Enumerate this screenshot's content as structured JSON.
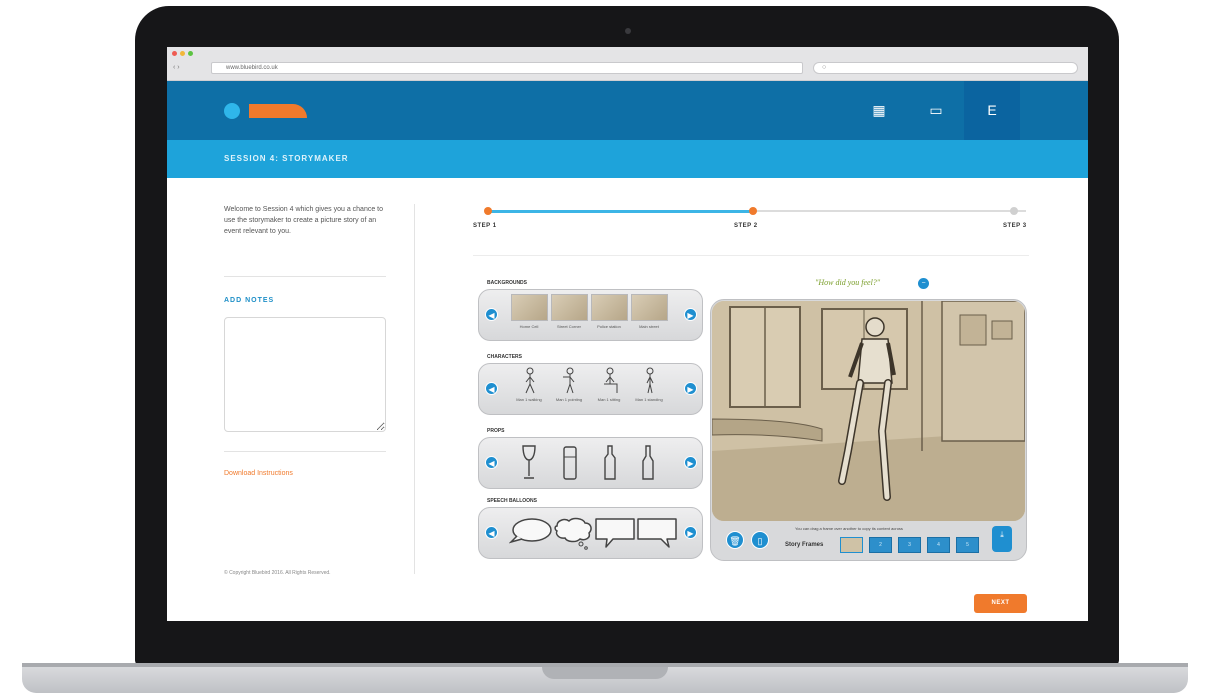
{
  "browser": {
    "url": "www.bluebird.co.uk",
    "nav": "‹ ›"
  },
  "header": {
    "nav_icons": [
      {
        "name": "grid-icon",
        "glyph": "▦"
      },
      {
        "name": "book-icon",
        "glyph": "▭"
      },
      {
        "name": "menu-icon",
        "glyph": "E"
      }
    ]
  },
  "session": {
    "title": "SESSION 4: STORYMAKER"
  },
  "sidebar": {
    "intro": "Welcome to Session 4 which gives you a chance to use the storymaker to create a picture story of an event relevant to you.",
    "notes_heading": "ADD NOTES",
    "notes_value": "",
    "download_link": "Download Instructions",
    "copyright": "© Copyright Bluebird 2016. All Rights Reserved."
  },
  "progress": {
    "steps": [
      "STEP 1",
      "STEP 2",
      "STEP 3"
    ],
    "current_step": 2,
    "colors": {
      "done": "#f07a2c",
      "pending": "#d0d0d0",
      "track": "#3cb5e6"
    }
  },
  "assets": {
    "backgrounds": {
      "label": "BACKGROUNDS",
      "items": [
        "Home Cell",
        "Street Corner",
        "Police station",
        "Main street"
      ]
    },
    "characters": {
      "label": "CHARACTERS",
      "items": [
        "Man 1 walking",
        "Man 1 pointing",
        "Man 1 sitting",
        "Man 1 standing"
      ],
      "icons": [
        "character-walking-icon",
        "character-pointing-icon",
        "character-sitting-icon",
        "character-standing-icon"
      ]
    },
    "props": {
      "label": "PROPS",
      "icons": [
        "wine-glass-icon",
        "can-icon",
        "bottle-icon",
        "wine-bottle-icon"
      ]
    },
    "balloons": {
      "label": "SPEECH BALLOONS",
      "icons": [
        "speech-bubble-oval-icon",
        "thought-bubble-icon",
        "speech-bubble-box-icon",
        "speech-bubble-box-right-icon"
      ]
    }
  },
  "scene": {
    "prompt": "\"How did you feel?\"",
    "hint": "You can drag a frame over another to copy its content across",
    "frames_label": "Story Frames",
    "frames": [
      "1",
      "2",
      "3",
      "4",
      "5"
    ],
    "selected_frame": 1
  },
  "footer": {
    "next_label": "NEXT"
  },
  "colors": {
    "header": "#0e6fa6",
    "subbar": "#1ea3da",
    "accent": "#f07a2c",
    "button": "#1f8fd0"
  }
}
